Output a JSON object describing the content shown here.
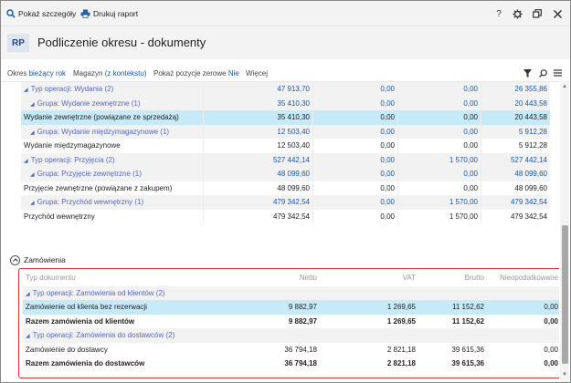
{
  "toolbar": {
    "show_details": "Pokaż szczegóły",
    "print_report": "Drukuj raport",
    "help": "?"
  },
  "header": {
    "badge": "RP",
    "title": "Podliczenie okresu - dokumenty"
  },
  "filters": {
    "period_label": "Okres",
    "period_value": "bieżący rok",
    "warehouse_label": "Magazyn",
    "warehouse_value": "(z kontekstu)",
    "zero_label": "Pokaż pozycje zerowe",
    "zero_value": "Nie",
    "more": "Więcej"
  },
  "documents": {
    "rows": [
      {
        "kind": "group",
        "level": 1,
        "name": "Typ operacji: Wydania (2)",
        "netto": "47 913,70",
        "vat": "0,00",
        "brutto": "0,00",
        "nieop": "26 355,86"
      },
      {
        "kind": "group",
        "level": 2,
        "name": "Grupa: Wydanie zewnętrzne (1)",
        "netto": "35 410,30",
        "vat": "0,00",
        "brutto": "0,00",
        "nieop": "20 443,58"
      },
      {
        "kind": "selected",
        "level": 0,
        "name": "Wydanie zewnętrzne (powiązane ze sprzedażą)",
        "netto": "35 410,30",
        "vat": "0,00",
        "brutto": "0,00",
        "nieop": "20 443,58"
      },
      {
        "kind": "group",
        "level": 2,
        "name": "Grupa: Wydanie międzymagazynowe (1)",
        "netto": "12 503,40",
        "vat": "0,00",
        "brutto": "0,00",
        "nieop": "5 912,28"
      },
      {
        "kind": "normal",
        "level": 0,
        "name": "Wydanie międzymagazynowe",
        "netto": "12 503,40",
        "vat": "0,00",
        "brutto": "0,00",
        "nieop": "5 912,28"
      },
      {
        "kind": "group",
        "level": 1,
        "name": "Typ operacji: Przyjęcia (2)",
        "netto": "527 442,14",
        "vat": "0,00",
        "brutto": "1 570,00",
        "nieop": "527 442,14"
      },
      {
        "kind": "group",
        "level": 2,
        "name": "Grupa: Przyjęcie zewnętrzne (1)",
        "netto": "48 099,60",
        "vat": "0,00",
        "brutto": "0,00",
        "nieop": "48 099,60"
      },
      {
        "kind": "normal",
        "level": 0,
        "name": "Przyjęcie zewnętrzne (powiązane z zakupem)",
        "netto": "48 099,60",
        "vat": "0,00",
        "brutto": "0,00",
        "nieop": "48 099,60"
      },
      {
        "kind": "group",
        "level": 2,
        "name": "Grupa: Przychód wewnętrzny (1)",
        "netto": "479 342,54",
        "vat": "0,00",
        "brutto": "1 570,00",
        "nieop": "479 342,54"
      },
      {
        "kind": "normal",
        "level": 0,
        "name": "Przychód wewnętrzny",
        "netto": "479 342,54",
        "vat": "0,00",
        "brutto": "1 570,00",
        "nieop": "479 342,54"
      }
    ]
  },
  "orders": {
    "section_title": "Zamówienia",
    "headers": [
      "Typ dokumentu",
      "Netto",
      "VAT",
      "Brutto",
      "Nieopodatkowane"
    ],
    "rows": [
      {
        "kind": "group",
        "name": "Typ operacji: Zamówienia od klientów (2)",
        "netto": "",
        "vat": "",
        "brutto": "",
        "nieop": ""
      },
      {
        "kind": "selected",
        "name": "Zamówienie od klienta bez rezerwacji",
        "netto": "9 882,97",
        "vat": "1 269,65",
        "brutto": "11 152,62",
        "nieop": "0,00"
      },
      {
        "kind": "bold",
        "name": "Razem zamówienia od klientów",
        "netto": "9 882,97",
        "vat": "1 269,65",
        "brutto": "11 152,62",
        "nieop": "0,00"
      },
      {
        "kind": "group",
        "name": "Typ operacji: Zamówienia do dostawców (2)",
        "netto": "",
        "vat": "",
        "brutto": "",
        "nieop": ""
      },
      {
        "kind": "normal",
        "name": "Zamówienie do dostawcy",
        "netto": "36 794,18",
        "vat": "2 821,18",
        "brutto": "39 615,36",
        "nieop": "0,00"
      },
      {
        "kind": "bold",
        "name": "Razem zamówienia do dostawców",
        "netto": "36 794,18",
        "vat": "2 821,18",
        "brutto": "39 615,36",
        "nieop": "0,00"
      }
    ]
  },
  "colors": {
    "accent": "#1a55a8",
    "group_text": "#5467b8",
    "selected_row": "#c6eaf8",
    "highlight_border": "#d9303a"
  }
}
